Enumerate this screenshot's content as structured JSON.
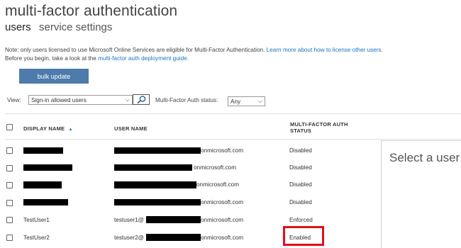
{
  "page": {
    "title": "multi-factor authentication",
    "tabs": [
      {
        "label": "users",
        "active": true
      },
      {
        "label": "service settings",
        "active": false
      }
    ]
  },
  "notice": {
    "line1_text": "Note: only users licensed to use Microsoft Online Services are eligible for Multi-Factor Authentication.",
    "line1_link": "Learn more about how to license other users.",
    "line2_text": "Before you begin, take a look at the",
    "line2_link": "multi-factor auth deployment guide."
  },
  "toolbar": {
    "bulk_update_label": "bulk update",
    "view_label": "View:",
    "view_value": "Sign-in allowed users",
    "search_icon": "search-icon",
    "status_label": "Multi-Factor Auth status:",
    "status_value": "Any"
  },
  "table": {
    "columns": [
      "DISPLAY NAME",
      "USER NAME",
      "MULTI-FACTOR AUTH",
      "STATUS"
    ],
    "sort_indicator": "▲",
    "rows": [
      {
        "display_name": "",
        "user_prefix": "",
        "user_suffix": "onmicrosoft.com",
        "status": "Disabled"
      },
      {
        "display_name": "",
        "user_prefix": "",
        "user_suffix": "onmicrosoft.com",
        "status": "Disabled"
      },
      {
        "display_name": "",
        "user_prefix": "",
        "user_suffix": "onmicrosoft.com",
        "status": "Disabled"
      },
      {
        "display_name": "",
        "user_prefix": "",
        "user_suffix": "onmicrosoft.com",
        "status": "Disabled"
      },
      {
        "display_name": "TestUser1",
        "user_prefix": "testuser1@",
        "user_suffix": "onmicrosoft.com",
        "status": "Enforced"
      },
      {
        "display_name": "TestUser2",
        "user_prefix": "testuser2@",
        "user_suffix": "onmicrosoft.com",
        "status": "Enabled"
      }
    ]
  },
  "side_panel": {
    "message": "Select a user"
  },
  "colors": {
    "accent": "#4d7bab",
    "link": "#1b74c5",
    "highlight": "#e0101b"
  }
}
